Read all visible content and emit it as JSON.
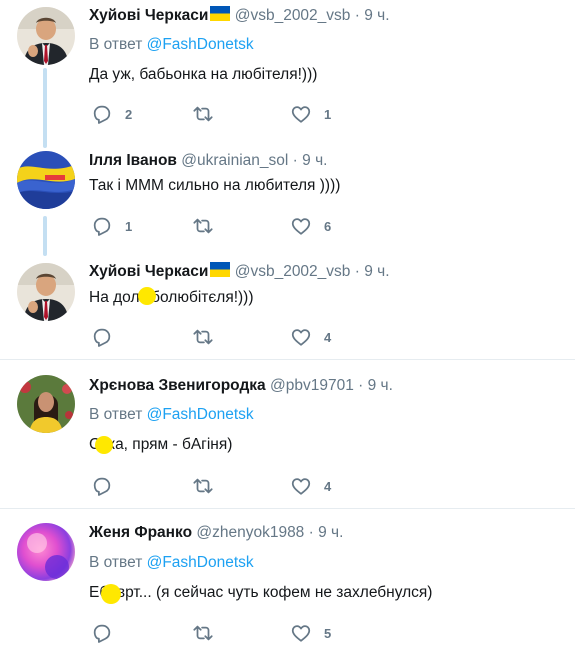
{
  "tweets": [
    {
      "name": "Хуйові Черкаси",
      "handle": "@vsb_2002_vsb",
      "time": "9 ч.",
      "reply_prefix": "В ответ",
      "reply_to": "@FashDonetsk",
      "text": "Да уж, бабьонка на любітеля!)))",
      "replies": "2",
      "retweets": "",
      "likes": "1"
    },
    {
      "name": "Ілля Іванов",
      "handle": "@ukrainian_sol",
      "time": "9 ч.",
      "text": "Так і МММ сильно на любителя ))))",
      "replies": "1",
      "retweets": "",
      "likes": "6"
    },
    {
      "name": "Хуйові Черкаси",
      "handle": "@vsb_2002_vsb",
      "time": "9 ч.",
      "text": "На долюболюбітєля!)))",
      "replies": "",
      "retweets": "",
      "likes": "4"
    },
    {
      "name": "Хрєнова Звенигородка",
      "handle": "@pbv19701",
      "time": "9 ч.",
      "reply_prefix": "В ответ",
      "reply_to": "@FashDonetsk",
      "text": "Сука, прям - бАгіня)",
      "replies": "",
      "retweets": "",
      "likes": "4"
    },
    {
      "name": "Женя Франко",
      "handle": "@zhenyok1988",
      "time": "9 ч.",
      "reply_prefix": "В ответ",
      "reply_to": "@FashDonetsk",
      "text": "Еб#врт... (я сейчас чуть кофем не захлебнулся)",
      "replies": "",
      "retweets": "",
      "likes": "5"
    }
  ],
  "dot": "·",
  "icons": {
    "reply": "reply-icon",
    "retweet": "retweet-icon",
    "like": "heart-icon",
    "flag": "ukraine-flag-icon"
  },
  "colors": {
    "accent": "#1da1f2",
    "muted": "#657786",
    "text": "#14171a",
    "thread": "#c4dff2",
    "separator": "#e6ecf0",
    "flag_blue": "#0057b7",
    "flag_yellow": "#ffd700",
    "redaction": "#ffe800"
  }
}
